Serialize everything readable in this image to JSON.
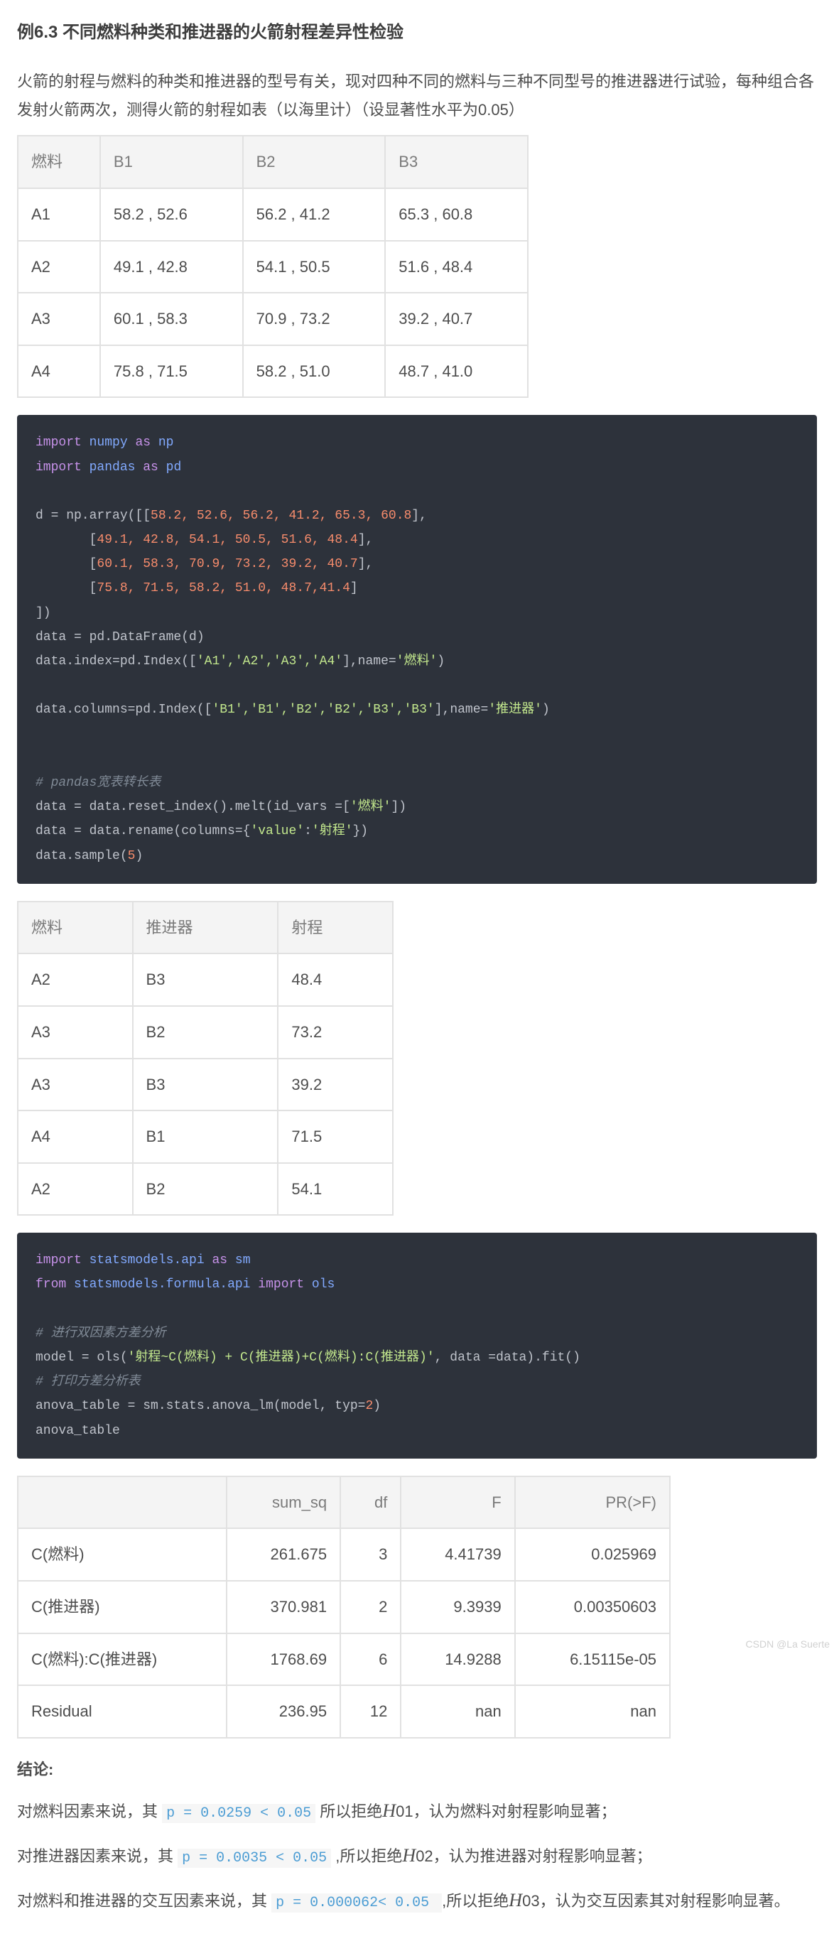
{
  "heading": "例6.3 不同燃料种类和推进器的火箭射程差异性检验",
  "intro": "火箭的射程与燃料的种类和推进器的型号有关，现对四种不同的燃料与三种不同型号的推进器进行试验，每种组合各发射火箭两次，测得火箭的射程如表（以海里计）（设显著性水平为0.05）",
  "table1": {
    "headers": [
      "燃料",
      "B1",
      "B2",
      "B3"
    ],
    "rows": [
      [
        "A1",
        "58.2 , 52.6",
        "56.2 , 41.2",
        "65.3 , 60.8"
      ],
      [
        "A2",
        "49.1 , 42.8",
        "54.1 , 50.5",
        "51.6 , 48.4"
      ],
      [
        "A3",
        "60.1 , 58.3",
        "70.9 , 73.2",
        "39.2 , 40.7"
      ],
      [
        "A4",
        "75.8 , 71.5",
        "58.2 , 51.0",
        "48.7 , 41.0"
      ]
    ]
  },
  "code1": {
    "l1a": "import",
    "l1b": "numpy",
    "l1c": "as",
    "l1d": "np",
    "l2a": "import",
    "l2b": "pandas",
    "l2c": "as",
    "l2d": "pd",
    "arr_open": "d = np.array([[",
    "arr_r1": "58.2, 52.6, 56.2, 41.2, 65.3, 60.8",
    "arr_r2": "49.1, 42.8, 54.1, 50.5, 51.6, 48.4",
    "arr_r3": "60.1, 58.3, 70.9, 73.2, 39.2, 40.7",
    "arr_r4": "75.8, 71.5, 58.2, 51.0, 48.7,41.4",
    "arr_close": "])",
    "df": "data = pd.DataFrame(d)",
    "idx_pre": "data.index=pd.Index([",
    "idx_a": "'A1','A2','A3','A4'",
    "idx_post": "],name=",
    "idx_name": "'燃料'",
    "idx_end": ")",
    "col_pre": "data.columns=pd.Index([",
    "col_b": "'B1','B1','B2','B2','B3','B3'",
    "col_post": "],name=",
    "col_name": "'推进器'",
    "col_end": ")",
    "cmt1": "# pandas宽表转长表",
    "melt_pre": "data = data.reset_index().melt(id_vars =[",
    "melt_s": "'燃料'",
    "melt_post": "])",
    "ren_pre": "data = data.rename(columns={",
    "ren_k": "'value'",
    "ren_colon": ":",
    "ren_v": "'射程'",
    "ren_post": "})",
    "sample": "data.sample(",
    "sample_n": "5",
    "sample_end": ")"
  },
  "table2": {
    "headers": [
      "燃料",
      "推进器",
      "射程"
    ],
    "rows": [
      [
        "A2",
        "B3",
        "48.4"
      ],
      [
        "A3",
        "B2",
        "73.2"
      ],
      [
        "A3",
        "B3",
        "39.2"
      ],
      [
        "A4",
        "B1",
        "71.5"
      ],
      [
        "A2",
        "B2",
        "54.1"
      ]
    ]
  },
  "code2": {
    "l1a": "import",
    "l1b": "statsmodels.api",
    "l1c": "as",
    "l1d": "sm",
    "l2a": "from",
    "l2b": "statsmodels.formula.api",
    "l2c": "import",
    "l2d": "ols",
    "cmt1": "# 进行双因素方差分析",
    "ols_pre": "model = ols(",
    "ols_s": "'射程~C(燃料) + C(推进器)+C(燃料):C(推进器)'",
    "ols_post": ", data =data).fit()",
    "cmt2": "# 打印方差分析表",
    "anova_pre": "anova_table = sm.stats.anova_lm(model, typ=",
    "anova_n": "2",
    "anova_post": ")",
    "last": "anova_table"
  },
  "table3": {
    "headers": [
      "",
      "sum_sq",
      "df",
      "F",
      "PR(>F)"
    ],
    "rows": [
      [
        "C(燃料)",
        "261.675",
        "3",
        "4.41739",
        "0.025969"
      ],
      [
        "C(推进器)",
        "370.981",
        "2",
        "9.3939",
        "0.00350603"
      ],
      [
        "C(燃料):C(推进器)",
        "1768.69",
        "6",
        "14.9288",
        "6.15115e-05"
      ],
      [
        "Residual",
        "236.95",
        "12",
        "nan",
        "nan"
      ]
    ]
  },
  "conclusion_label": "结论:",
  "c1": {
    "pre": "对燃料因素来说，其 ",
    "code": "p = 0.0259 < 0.05",
    "mid": " 所以拒绝",
    "h": "H",
    "sub": "01",
    "post": "，认为燃料对射程影响显著；"
  },
  "c2": {
    "pre": "对推进器因素来说，其 ",
    "code": "p = 0.0035 < 0.05",
    "mid": " ,所以拒绝",
    "h": "H",
    "sub": "02",
    "post": "，认为推进器对射程影响显著；"
  },
  "c3": {
    "pre": "对燃料和推进器的交互因素来说，其 ",
    "code": "p = 0.000062< 0.05 ",
    "mid": " ,所以拒绝",
    "h": "H",
    "sub": "03",
    "post": "，认为交互因素其对射程影响显著。"
  },
  "watermark": "CSDN @La Suerte"
}
